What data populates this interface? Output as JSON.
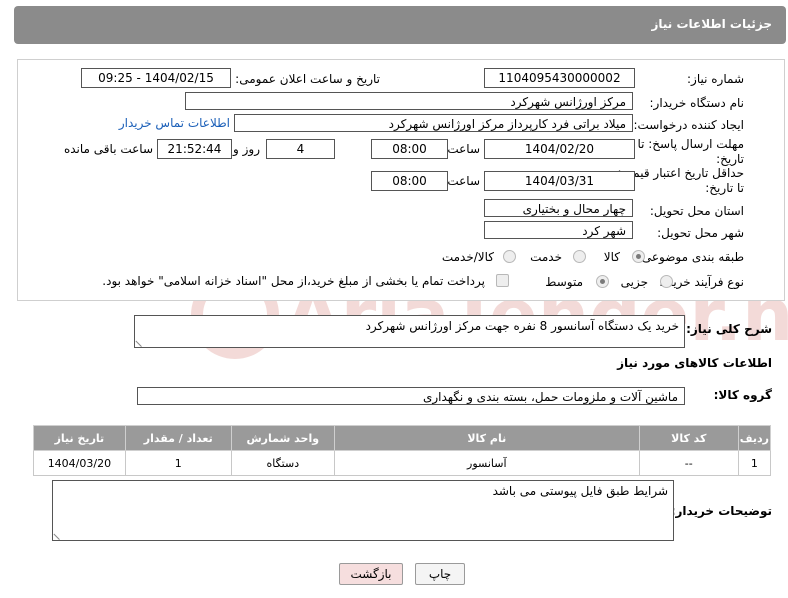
{
  "header": {
    "title": "جزئیات اطلاعات نیاز"
  },
  "form": {
    "need_number_label": "شماره نیاز:",
    "need_number": "1104095430000002",
    "announce_label": "تاریخ و ساعت اعلان عمومی:",
    "announce_value": "1404/02/15 - 09:25",
    "buyer_org_label": "نام دستگاه خریدار:",
    "buyer_org": "مرکز اورژانس شهرکرد",
    "creator_label": "ایجاد کننده درخواست:",
    "creator": "میلاد براتی فرد کارپرداز مرکز اورژانس شهرکرد",
    "contact_link": "اطلاعات تماس خریدار",
    "reply_deadline_label": "مهلت ارسال پاسخ: تا تاریخ:",
    "reply_date": "1404/02/20",
    "time_label": "ساعت",
    "reply_time": "08:00",
    "days_value": "4",
    "days_label": "روز و",
    "remaining_value": "21:52:44",
    "remaining_label": "ساعت باقی مانده",
    "price_validity_label": "حداقل تاریخ اعتبار قیمت: تا تاریخ:",
    "price_date": "1404/03/31",
    "price_time": "08:00",
    "province_label": "استان محل تحویل:",
    "province": "چهار محال و بختیاری",
    "city_label": "شهر محل تحویل:",
    "city": "شهر کرد",
    "category_label": "طبقه بندی موضوعی:",
    "category_options": [
      "کالا",
      "خدمت",
      "کالا/خدمت"
    ],
    "process_label": "نوع فرآیند خرید :",
    "process_options": [
      "جزیی",
      "متوسط"
    ],
    "payment_note": "پرداخت تمام یا بخشی از مبلغ خرید،از محل \"اسناد خزانه اسلامی\" خواهد بود."
  },
  "description": {
    "label": "شرح کلی نیاز:",
    "value": "خرید یک دستگاه آسانسور 8 نفره جهت مرکز اورژانس شهرکرد"
  },
  "goods_info_title": "اطلاعات کالاهای مورد نیاز",
  "goods_group": {
    "label": "گروه کالا:",
    "value": "ماشین آلات و ملزومات حمل، بسته بندی و نگهداری"
  },
  "table": {
    "headers": [
      "ردیف",
      "کد کالا",
      "نام کالا",
      "واحد شمارش",
      "تعداد / مقدار",
      "تاریخ نیاز"
    ],
    "rows": [
      [
        "1",
        "--",
        "آسانسور",
        "دستگاه",
        "1",
        "1404/03/20"
      ]
    ]
  },
  "buyer_notes": {
    "label": "توضیحات خریدار:",
    "value": "شرایط طبق فایل پیوستی می باشد"
  },
  "buttons": {
    "print": "چاپ",
    "back": "بازگشت"
  },
  "watermark_text": "AriaTender.net"
}
